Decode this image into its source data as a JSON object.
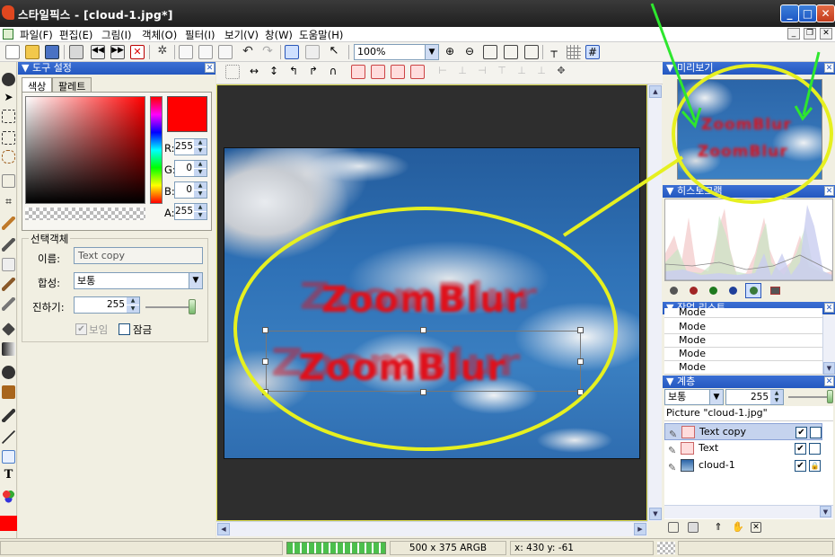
{
  "window": {
    "title": "스타일픽스 - [cloud-1.jpg*]",
    "minimize": "_",
    "maximize": "□",
    "close": "✕"
  },
  "menu": {
    "items": [
      "파일(F)",
      "편집(E)",
      "그림(I)",
      "객체(O)",
      "필터(I)",
      "보기(V)",
      "창(W)",
      "도움말(H)"
    ],
    "mdi_min": "_",
    "mdi_restore": "❐",
    "mdi_close": "✕"
  },
  "toolbar": {
    "zoom": "100%"
  },
  "tool_panel": {
    "title": "▼ 도구 설정",
    "tabs": [
      "색상",
      "팔레트"
    ],
    "active_tab": 0,
    "rgba": {
      "r": "255",
      "g": "0",
      "b": "0",
      "a": "255"
    },
    "labels": {
      "r": "R:",
      "g": "G:",
      "b": "B:",
      "a": "A:"
    },
    "current_color": "#ff0000",
    "object_group": "선택객체",
    "name_label": "이름:",
    "name_value": "Text copy",
    "blend_label": "합성:",
    "blend_value": "보통",
    "opacity_label": "진하기:",
    "opacity_value": "255",
    "visible_label": "보임",
    "visible_checked": true,
    "lock_label": "잠금",
    "lock_checked": false
  },
  "canvas": {
    "text_top": "ZoomBlur",
    "text_bottom": "ZoomBlur",
    "accent_color": "#e0101a",
    "annotation_color": "#e6f020",
    "arrow_color": "#2ee62e"
  },
  "preview_panel": {
    "title": "▼ 미리보기"
  },
  "histogram_panel": {
    "title": "▼ 히스토그램",
    "channels": [
      "gray",
      "red",
      "green",
      "blue",
      "all",
      "image"
    ]
  },
  "history_panel": {
    "title": "▼ 작업 리스트",
    "items": [
      "Mode",
      "Mode",
      "Mode",
      "Mode",
      "Mode"
    ]
  },
  "layer_panel": {
    "title": "▼ 계층",
    "blend": "보통",
    "opacity": "255",
    "picture_label": "Picture \"cloud-1.jpg\"",
    "layers": [
      {
        "name": "Text copy",
        "selected": true,
        "visible": true,
        "locked": false
      },
      {
        "name": "Text",
        "selected": false,
        "visible": true,
        "locked": false
      },
      {
        "name": "cloud-1",
        "selected": false,
        "visible": true,
        "locked": true
      }
    ]
  },
  "statusbar": {
    "progress": 1.0,
    "image_info": "500 x 375 ARGB",
    "coords": "x: 430 y: -61"
  }
}
